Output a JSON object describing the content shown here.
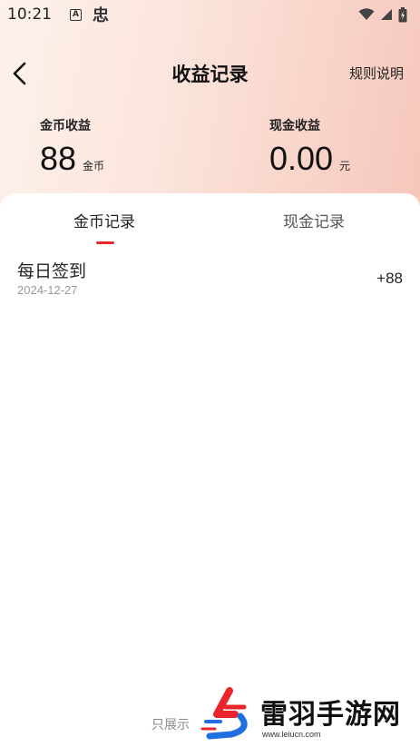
{
  "status_bar": {
    "time": "10:21",
    "a_badge": "A",
    "bug_icon": "忠"
  },
  "nav": {
    "title": "收益记录",
    "rules_label": "规则说明"
  },
  "coins": {
    "label": "金币收益",
    "value": "88",
    "unit": "金币"
  },
  "cash": {
    "label": "现金收益",
    "value": "0.00",
    "unit": "元"
  },
  "tabs": [
    {
      "label": "金币记录",
      "active": true
    },
    {
      "label": "现金记录",
      "active": false
    }
  ],
  "records": [
    {
      "title": "每日签到",
      "date": "2024-12-27",
      "amount": "+88"
    }
  ],
  "footer": {
    "note": "只展示"
  },
  "watermark": {
    "name": "雷羽手游网",
    "url": "www.leiucn.com"
  },
  "colors": {
    "accent": "#e8262c",
    "header_gradient_start": "#fdf1ec",
    "header_gradient_end": "#f6c7bb",
    "muted_text": "#999999"
  }
}
